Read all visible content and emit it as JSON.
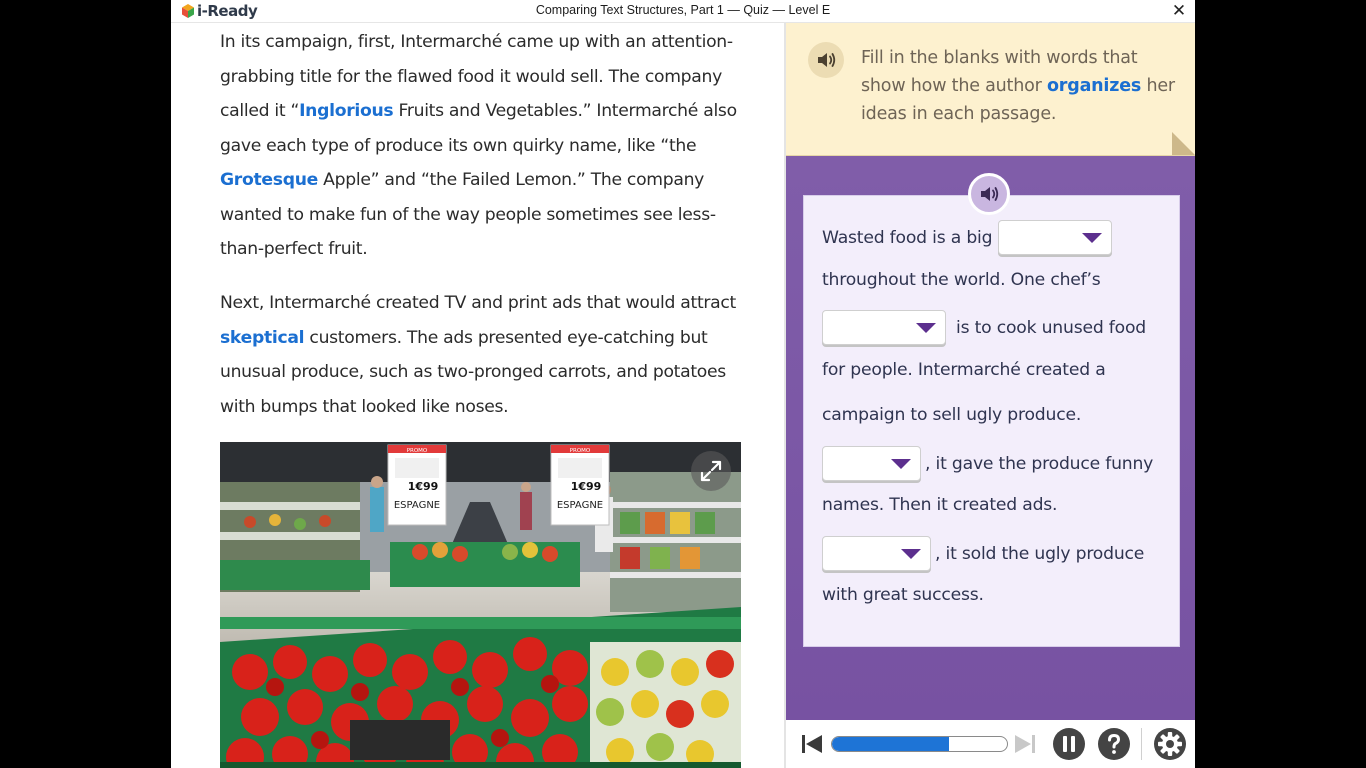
{
  "app": {
    "logo_text": "i-Ready",
    "window_title": "Comparing Text Structures, Part 1 — Quiz — Level E",
    "close_glyph": "✕"
  },
  "reading": {
    "p1": {
      "t1": "In its campaign, first, Intermarché came up with an attention-grabbing title for the flawed food it would sell. The company called it “",
      "k1": "Inglorious",
      "t2": " Fruits and Vegetables.” Intermarché also gave each type of produce its own quirky name, like “the ",
      "k2": "Grotesque",
      "t3": " Apple” and “the Failed Lemon.” The company wanted to make fun of the way people sometimes see less-than-perfect fruit."
    },
    "p2": {
      "t1": "Next, Intermarché created TV and print ads that would attract ",
      "k1": "skeptical",
      "t2": " customers. The ads presented eye-catching but unusual produce, such as two-pronged carrots, and potatoes with bumps that looked like noses."
    },
    "photo": {
      "sign_promo": "PROMO",
      "sign_price": "1€99",
      "sign_origin": "ESPAGNE"
    }
  },
  "instructions": {
    "t1": "Fill in the blanks with words that show how the author ",
    "kw": "organizes",
    "t2": " her ideas in each passage."
  },
  "question": {
    "line1": "Wasted food is a big",
    "line2": "throughout the world. One chef’s",
    "line3": "is to cook unused food",
    "line4": "for people. Intermarché created a",
    "line5": "campaign to sell ugly produce.",
    "line6": ", it gave the produce funny",
    "line7": "names. Then it created ads.",
    "line8": ", it sold the ugly produce",
    "line9": "with great success."
  },
  "colors": {
    "keyword": "#1b6fd1",
    "panel": "#7d5aa6",
    "instruction_bg": "#fdf1cf",
    "card_bg": "#f3eefb",
    "caret": "#5c2f8e",
    "progress": "#1e74d6"
  },
  "icons": {
    "speaker": "speaker-icon",
    "expand": "expand-icon",
    "back": "skip-back-icon",
    "forward": "skip-forward-icon",
    "pause": "pause-icon",
    "help": "help-icon",
    "settings": "gear-icon",
    "dropdown": "chevron-down-icon"
  },
  "progress": {
    "fraction": 0.67
  }
}
